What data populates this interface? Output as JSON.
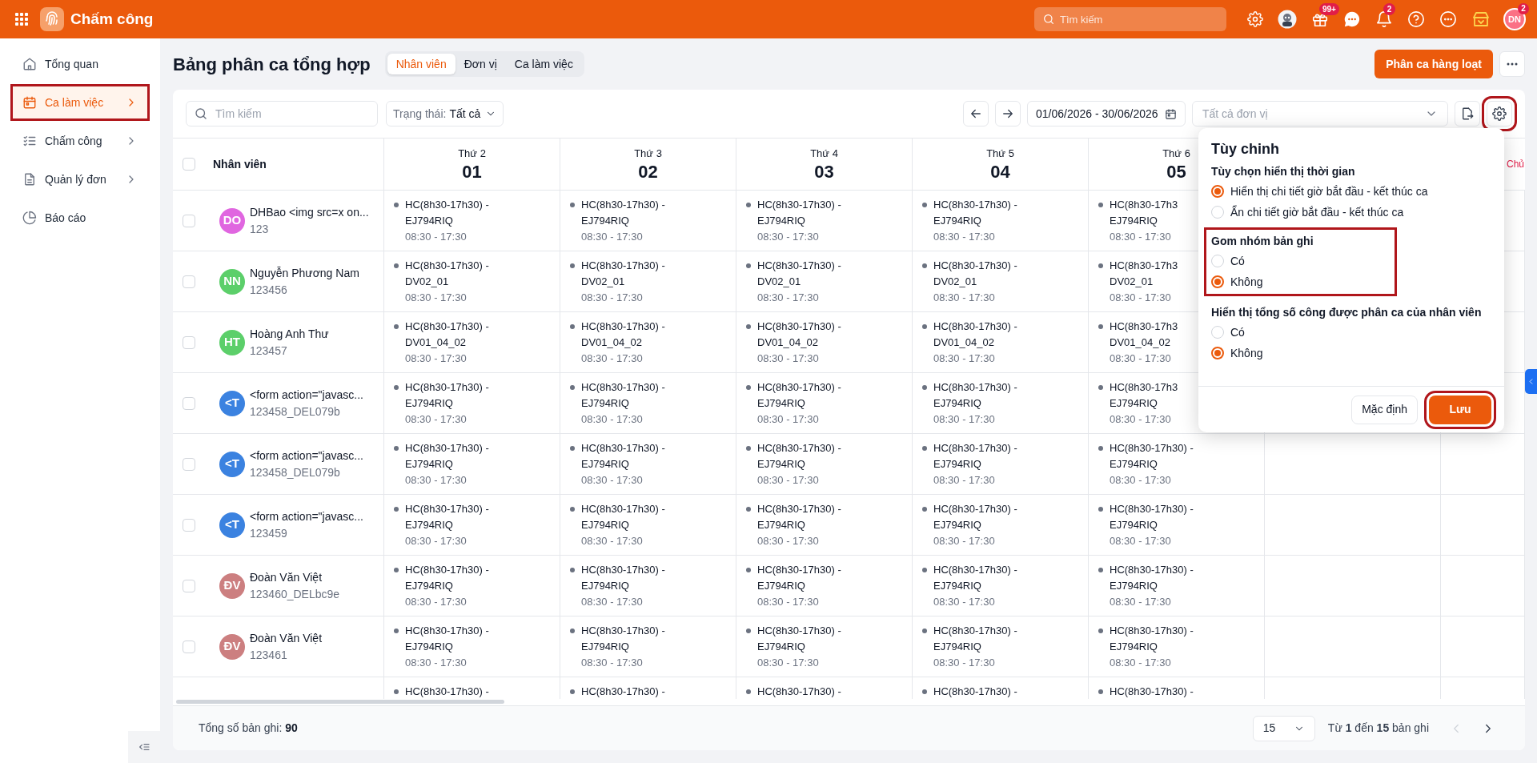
{
  "app": {
    "title": "Chấm công",
    "search_placeholder": "Tìm kiếm",
    "gift_badge": "99+",
    "bell_badge": "2",
    "user": {
      "initials": "DN",
      "badge": "2"
    }
  },
  "sidebar": {
    "items": [
      {
        "label": "Tổng quan",
        "selected": false,
        "expandable": false,
        "highlighted": false
      },
      {
        "label": "Ca làm việc",
        "selected": true,
        "expandable": true,
        "highlighted": true
      },
      {
        "label": "Chấm công",
        "selected": false,
        "expandable": true,
        "highlighted": false
      },
      {
        "label": "Quản lý đơn",
        "selected": false,
        "expandable": true,
        "highlighted": false
      },
      {
        "label": "Báo cáo",
        "selected": false,
        "expandable": false,
        "highlighted": false
      }
    ]
  },
  "page": {
    "title": "Bảng phân ca tổng hợp",
    "tabs": [
      {
        "label": "Nhân viên",
        "selected": true
      },
      {
        "label": "Đơn vị",
        "selected": false
      },
      {
        "label": "Ca làm việc",
        "selected": false
      }
    ],
    "primary_button": "Phân ca hàng loạt"
  },
  "toolbar": {
    "search_placeholder": "Tìm kiếm",
    "status_label": "Trạng thái:",
    "status_value": "Tất cả",
    "date_range": "01/06/2026 - 30/06/2026",
    "unit_placeholder": "Tất cả đơn vị",
    "settings_highlighted": true
  },
  "table": {
    "employee_header": "Nhân viên",
    "days": [
      {
        "weekday": "Thứ 2",
        "date": "01",
        "weekend": false
      },
      {
        "weekday": "Thứ 3",
        "date": "02",
        "weekend": false
      },
      {
        "weekday": "Thứ 4",
        "date": "03",
        "weekend": false
      },
      {
        "weekday": "Thứ 5",
        "date": "04",
        "weekend": false
      },
      {
        "weekday": "Thứ 6",
        "date": "05",
        "weekend": false
      },
      {
        "weekday": "Chủ",
        "weekend": true
      }
    ],
    "all_checked": false,
    "rows": [
      {
        "initials": "DO",
        "color": "#e066e0",
        "name": "DHBao <img src=x on...",
        "code": "123",
        "checked": false,
        "shifts": [
          {
            "shift": "HC(8h30-17h30) -",
            "unit": "EJ794RIQ",
            "time": "08:30 - 17:30"
          },
          {
            "shift": "HC(8h30-17h30) -",
            "unit": "EJ794RIQ",
            "time": "08:30 - 17:30"
          },
          {
            "shift": "HC(8h30-17h30) -",
            "unit": "EJ794RIQ",
            "time": "08:30 - 17:30"
          },
          {
            "shift": "HC(8h30-17h30) -",
            "unit": "EJ794RIQ",
            "time": "08:30 - 17:30"
          },
          {
            "shift": "HC(8h30-17h3",
            "unit": "EJ794RIQ",
            "time": "08:30 - 17:30"
          }
        ]
      },
      {
        "initials": "NN",
        "color": "#5ccf6a",
        "name": "Nguyễn Phương Nam",
        "code": "123456",
        "checked": false,
        "shifts": [
          {
            "shift": "HC(8h30-17h30) -",
            "unit": "DV02_01",
            "time": "08:30 - 17:30"
          },
          {
            "shift": "HC(8h30-17h30) -",
            "unit": "DV02_01",
            "time": "08:30 - 17:30"
          },
          {
            "shift": "HC(8h30-17h30) -",
            "unit": "DV02_01",
            "time": "08:30 - 17:30"
          },
          {
            "shift": "HC(8h30-17h30) -",
            "unit": "DV02_01",
            "time": "08:30 - 17:30"
          },
          {
            "shift": "HC(8h30-17h3",
            "unit": "DV02_01",
            "time": "08:30 - 17:30"
          }
        ]
      },
      {
        "initials": "HT",
        "color": "#5ccf6a",
        "name": "Hoàng Anh Thư",
        "code": "123457",
        "checked": false,
        "shifts": [
          {
            "shift": "HC(8h30-17h30) -",
            "unit": "DV01_04_02",
            "time": "08:30 - 17:30"
          },
          {
            "shift": "HC(8h30-17h30) -",
            "unit": "DV01_04_02",
            "time": "08:30 - 17:30"
          },
          {
            "shift": "HC(8h30-17h30) -",
            "unit": "DV01_04_02",
            "time": "08:30 - 17:30"
          },
          {
            "shift": "HC(8h30-17h30) -",
            "unit": "DV01_04_02",
            "time": "08:30 - 17:30"
          },
          {
            "shift": "HC(8h30-17h3",
            "unit": "DV01_04_02",
            "time": "08:30 - 17:30"
          }
        ]
      },
      {
        "initials": "<T",
        "color": "#3b82e0",
        "name": "<form action=\"javasc...",
        "code": "123458_DEL079b",
        "checked": false,
        "shifts": [
          {
            "shift": "HC(8h30-17h30) -",
            "unit": "EJ794RIQ",
            "time": "08:30 - 17:30"
          },
          {
            "shift": "HC(8h30-17h30) -",
            "unit": "EJ794RIQ",
            "time": "08:30 - 17:30"
          },
          {
            "shift": "HC(8h30-17h30) -",
            "unit": "EJ794RIQ",
            "time": "08:30 - 17:30"
          },
          {
            "shift": "HC(8h30-17h30) -",
            "unit": "EJ794RIQ",
            "time": "08:30 - 17:30"
          },
          {
            "shift": "HC(8h30-17h3",
            "unit": "EJ794RIQ",
            "time": "08:30 - 17:30"
          }
        ]
      },
      {
        "initials": "<T",
        "color": "#3b82e0",
        "name": "<form action=\"javasc...",
        "code": "123458_DEL079b",
        "checked": false,
        "shifts": [
          {
            "shift": "HC(8h30-17h30) -",
            "unit": "EJ794RIQ",
            "time": "08:30 - 17:30"
          },
          {
            "shift": "HC(8h30-17h30) -",
            "unit": "EJ794RIQ",
            "time": "08:30 - 17:30"
          },
          {
            "shift": "HC(8h30-17h30) -",
            "unit": "EJ794RIQ",
            "time": "08:30 - 17:30"
          },
          {
            "shift": "HC(8h30-17h30) -",
            "unit": "EJ794RIQ",
            "time": "08:30 - 17:30"
          },
          {
            "shift": "HC(8h30-17h30) -",
            "unit": "EJ794RIQ",
            "time": "08:30 - 17:30"
          }
        ]
      },
      {
        "initials": "<T",
        "color": "#3b82e0",
        "name": "<form action=\"javasc...",
        "code": "123459",
        "checked": false,
        "shifts": [
          {
            "shift": "HC(8h30-17h30) -",
            "unit": "EJ794RIQ",
            "time": "08:30 - 17:30"
          },
          {
            "shift": "HC(8h30-17h30) -",
            "unit": "EJ794RIQ",
            "time": "08:30 - 17:30"
          },
          {
            "shift": "HC(8h30-17h30) -",
            "unit": "EJ794RIQ",
            "time": "08:30 - 17:30"
          },
          {
            "shift": "HC(8h30-17h30) -",
            "unit": "EJ794RIQ",
            "time": "08:30 - 17:30"
          },
          {
            "shift": "HC(8h30-17h30) -",
            "unit": "EJ794RIQ",
            "time": "08:30 - 17:30"
          }
        ]
      },
      {
        "initials": "ĐV",
        "color": "#cc7f80",
        "name": "Đoàn Văn Việt",
        "code": "123460_DELbc9e",
        "checked": false,
        "shifts": [
          {
            "shift": "HC(8h30-17h30) -",
            "unit": "EJ794RIQ",
            "time": "08:30 - 17:30"
          },
          {
            "shift": "HC(8h30-17h30) -",
            "unit": "EJ794RIQ",
            "time": "08:30 - 17:30"
          },
          {
            "shift": "HC(8h30-17h30) -",
            "unit": "EJ794RIQ",
            "time": "08:30 - 17:30"
          },
          {
            "shift": "HC(8h30-17h30) -",
            "unit": "EJ794RIQ",
            "time": "08:30 - 17:30"
          },
          {
            "shift": "HC(8h30-17h30) -",
            "unit": "EJ794RIQ",
            "time": "08:30 - 17:30"
          }
        ]
      },
      {
        "initials": "ĐV",
        "color": "#cc7f80",
        "name": "Đoàn Văn Việt",
        "code": "123461",
        "checked": false,
        "shifts": [
          {
            "shift": "HC(8h30-17h30) -",
            "unit": "EJ794RIQ",
            "time": "08:30 - 17:30"
          },
          {
            "shift": "HC(8h30-17h30) -",
            "unit": "EJ794RIQ",
            "time": "08:30 - 17:30"
          },
          {
            "shift": "HC(8h30-17h30) -",
            "unit": "EJ794RIQ",
            "time": "08:30 - 17:30"
          },
          {
            "shift": "HC(8h30-17h30) -",
            "unit": "EJ794RIQ",
            "time": "08:30 - 17:30"
          },
          {
            "shift": "HC(8h30-17h30) -",
            "unit": "EJ794RIQ",
            "time": "08:30 - 17:30"
          }
        ]
      },
      {
        "shifts": [
          {
            "shift": "HC(8h30-17h30) -"
          },
          {
            "shift": "HC(8h30-17h30) -"
          },
          {
            "shift": "HC(8h30-17h30) -"
          },
          {
            "shift": "HC(8h30-17h30) -"
          },
          {
            "shift": "HC(8h30-17h30) -"
          }
        ]
      }
    ]
  },
  "footer": {
    "total_label": "Tổng số bản ghi:",
    "total": "90",
    "page_size": "15",
    "range": "Từ **1** đến **15** bản ghi"
  },
  "settings": {
    "title": "Tùy chinh",
    "groups": [
      {
        "title": "Tùy chọn hiển thị thời gian",
        "highlighted": false,
        "options": [
          {
            "label": "Hiển thị chi tiết giờ bắt đầu - kết thúc ca",
            "selected": true
          },
          {
            "label": "Ẩn chi tiết giờ bắt đầu - kết thúc ca",
            "selected": false
          }
        ]
      },
      {
        "title": "Gom nhóm bản ghi",
        "highlighted": true,
        "options": [
          {
            "label": "Có",
            "selected": false
          },
          {
            "label": "Không",
            "selected": true
          }
        ]
      },
      {
        "title": "Hiển thị tổng số công được phân ca của nhân viên",
        "highlighted": false,
        "options": [
          {
            "label": "Có",
            "selected": false
          },
          {
            "label": "Không",
            "selected": true
          }
        ]
      }
    ],
    "buttons": [
      {
        "label": "Mặc định",
        "kind": "secondary",
        "highlighted": false
      },
      {
        "label": "Lưu",
        "kind": "primary",
        "highlighted": true
      }
    ]
  }
}
